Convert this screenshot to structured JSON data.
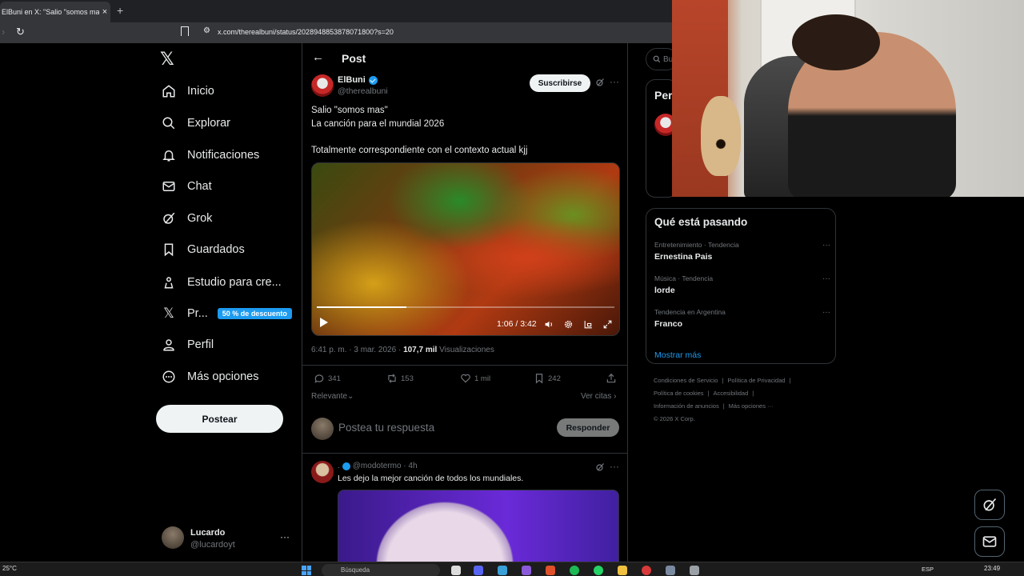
{
  "browser": {
    "tab_title": "ElBuni en X: \"Salio \"somos mas\"",
    "tab_close": "×",
    "new_tab": "+",
    "url": "x.com/therealbuni/status/2028948853878071800?s=20"
  },
  "nav": {
    "items": [
      {
        "label": "Inicio",
        "icon": "home-icon"
      },
      {
        "label": "Explorar",
        "icon": "search-icon"
      },
      {
        "label": "Notificaciones",
        "icon": "bell-icon"
      },
      {
        "label": "Chat",
        "icon": "mail-icon"
      },
      {
        "label": "Grok",
        "icon": "grok-icon"
      },
      {
        "label": "Guardados",
        "icon": "bookmark-icon"
      },
      {
        "label": "Estudio para cre...",
        "icon": "studio-icon"
      },
      {
        "label": "Pr...",
        "icon": "x-premium-icon"
      },
      {
        "label": "Perfil",
        "icon": "person-icon"
      },
      {
        "label": "Más opciones",
        "icon": "more-circle-icon"
      }
    ],
    "promo_badge": "50 % de descuento",
    "post_button": "Postear",
    "account": {
      "name": "Lucardo",
      "handle": "@lucardoyt",
      "more": "···"
    }
  },
  "post": {
    "header_title": "Post",
    "back": "←",
    "author_name": "ElBuni",
    "author_handle": "@therealbuni",
    "subscribe": "Suscribirse",
    "more": "···",
    "text": "Salio \"somos mas\"\nLa canción para el mundial 2026\n\nTotalmente correspondiente con el contexto actual kjj",
    "video": {
      "time": "1:06 / 3:42",
      "progress": 0.3
    },
    "meta_time": "6:41 p. m. · 3 mar. 2026 · ",
    "meta_views": "107,7 mil",
    "meta_views_label": " Visualizaciones",
    "stats": {
      "replies": "341",
      "reposts": "153",
      "likes": "1 mil",
      "bookmarks": "242"
    },
    "relevante": "Relevante⌄",
    "ver_citas": "Ver citas ›",
    "reply_placeholder": "Postea tu respuesta",
    "reply_button": "Responder"
  },
  "reply_tweet": {
    "name": ".",
    "handle_time": "@modotermo · 4h",
    "text": "Les dejo la mejor canción de todos los mundiales.",
    "more": "···"
  },
  "right": {
    "search_placeholder": "Bu",
    "who_title": "Per",
    "trends_title": "Qué está pasando",
    "trends": [
      {
        "category": "Entretenimiento · Tendencia",
        "name": "Ernestina Pais"
      },
      {
        "category": "Música · Tendencia",
        "name": "lorde"
      },
      {
        "category": "Tendencia en Argentina",
        "name": "Franco"
      }
    ],
    "trend_more": "···",
    "show_more": "Mostrar más",
    "footer": {
      "l1a": "Condiciones de Servicio",
      "l1b": "Política de Privacidad",
      "l2a": "Política de cookies",
      "l2b": "Accesibilidad",
      "l3a": "Información de anuncios",
      "l3b": "Más opciones ···",
      "l4": "© 2026 X Corp.",
      "sep": "|"
    }
  },
  "taskbar": {
    "weather": "25°C",
    "search": "Búsqueda",
    "lang": "ESP",
    "time": "23:49"
  },
  "colors": {
    "accent": "#1d9bf0",
    "background": "#000000",
    "text": "#e7e9ea",
    "muted": "#71767b"
  }
}
